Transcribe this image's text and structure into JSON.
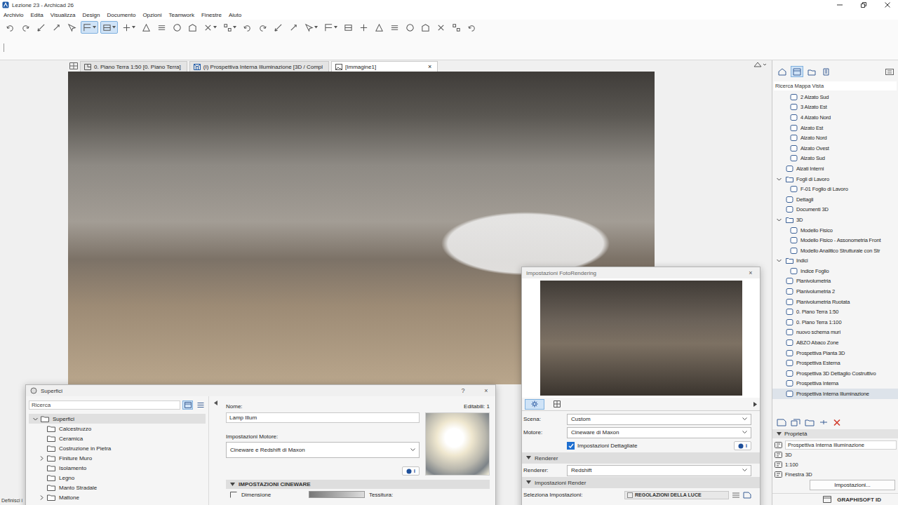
{
  "window": {
    "title": "Lezione 23 - Archicad 26"
  },
  "menu": [
    "Archivio",
    "Edita",
    "Visualizza",
    "Design",
    "Documento",
    "Opzioni",
    "Teamwork",
    "Finestre",
    "Aiuto"
  ],
  "toolbar": [
    {
      "selected": false,
      "menu": false
    },
    {
      "selected": false,
      "menu": false
    },
    {
      "selected": false,
      "menu": false
    },
    {
      "selected": false,
      "menu": false
    },
    {
      "selected": false,
      "menu": false
    },
    {
      "selected": true,
      "menu": true
    },
    {
      "selected": true,
      "menu": true
    },
    {
      "selected": false,
      "menu": true
    },
    {
      "selected": false,
      "menu": false
    },
    {
      "selected": false,
      "menu": false
    },
    {
      "selected": false,
      "menu": false
    },
    {
      "selected": false,
      "menu": false
    },
    {
      "selected": false,
      "menu": true
    },
    {
      "selected": false,
      "menu": true
    },
    {
      "selected": false,
      "menu": false
    },
    {
      "selected": false,
      "menu": false
    },
    {
      "selected": false,
      "menu": false
    },
    {
      "selected": false,
      "menu": false
    },
    {
      "selected": false,
      "menu": true
    },
    {
      "selected": false,
      "menu": true
    },
    {
      "selected": false,
      "menu": false
    },
    {
      "selected": false,
      "menu": false
    },
    {
      "selected": false,
      "menu": false
    },
    {
      "selected": false,
      "menu": false
    },
    {
      "selected": false,
      "menu": false
    },
    {
      "selected": false,
      "menu": false
    },
    {
      "selected": false,
      "menu": false
    },
    {
      "selected": false,
      "menu": false
    },
    {
      "selected": false,
      "menu": false
    }
  ],
  "view_tabs": [
    {
      "label": "0. Piano Terra 1:50 [0. Piano Terra]",
      "kind": "plan",
      "selected": false,
      "closable": false
    },
    {
      "label": "(I) Prospettiva Interna Illuminazione [3D / Compl",
      "kind": "perspective",
      "selected": false,
      "closable": false
    },
    {
      "label": "[Immagine1]",
      "kind": "image",
      "selected": true,
      "closable": true
    }
  ],
  "tab_close": "×",
  "status_hint": "Definisci i",
  "navigator": {
    "modes": [
      {
        "selected": false
      },
      {
        "selected": true
      },
      {
        "selected": false
      },
      {
        "selected": false
      }
    ],
    "search": "Ricerca Mappa Vista",
    "items": [
      {
        "label": "2 Alzato Sud",
        "kind": "view",
        "depth": 2,
        "expanded": false,
        "selected": false
      },
      {
        "label": "3 Alzato Est",
        "kind": "view",
        "depth": 2,
        "expanded": false,
        "selected": false
      },
      {
        "label": "4 Alzato Nord",
        "kind": "view",
        "depth": 2,
        "expanded": false,
        "selected": false
      },
      {
        "label": "Alzato Est",
        "kind": "view",
        "depth": 2,
        "expanded": false,
        "selected": false
      },
      {
        "label": "Alzato Nord",
        "kind": "view",
        "depth": 2,
        "expanded": false,
        "selected": false
      },
      {
        "label": "Alzato Ovest",
        "kind": "view",
        "depth": 2,
        "expanded": false,
        "selected": false
      },
      {
        "label": "Alzato Sud",
        "kind": "view",
        "depth": 2,
        "expanded": false,
        "selected": false
      },
      {
        "label": "Alzati Interni",
        "kind": "view",
        "depth": 1,
        "expanded": false,
        "selected": false
      },
      {
        "label": "Fogli di Lavoro",
        "kind": "folder",
        "depth": 1,
        "expanded": true,
        "selected": false
      },
      {
        "label": "F-01 Foglio di Lavoro",
        "kind": "view",
        "depth": 2,
        "expanded": false,
        "selected": false
      },
      {
        "label": "Dettagli",
        "kind": "view",
        "depth": 1,
        "expanded": false,
        "selected": false
      },
      {
        "label": "Documenti 3D",
        "kind": "view",
        "depth": 1,
        "expanded": false,
        "selected": false
      },
      {
        "label": "3D",
        "kind": "folder",
        "depth": 1,
        "expanded": true,
        "selected": false
      },
      {
        "label": "Modello Fisico",
        "kind": "view",
        "depth": 2,
        "expanded": false,
        "selected": false
      },
      {
        "label": "Modello Fisico - Assonometria Front",
        "kind": "view",
        "depth": 2,
        "expanded": false,
        "selected": false
      },
      {
        "label": "Modello Analitico Strutturale con Str",
        "kind": "view",
        "depth": 2,
        "expanded": false,
        "selected": false
      },
      {
        "label": "Indici",
        "kind": "folder",
        "depth": 1,
        "expanded": true,
        "selected": false
      },
      {
        "label": "Indice Foglio",
        "kind": "view",
        "depth": 2,
        "expanded": false,
        "selected": false
      },
      {
        "label": "Planivolumetria",
        "kind": "view",
        "depth": 1,
        "expanded": false,
        "selected": false
      },
      {
        "label": "Planivolumetria 2",
        "kind": "view",
        "depth": 1,
        "expanded": false,
        "selected": false
      },
      {
        "label": "Planivolumetria Ruotata",
        "kind": "view",
        "depth": 1,
        "expanded": false,
        "selected": false
      },
      {
        "label": "0. Piano Terra 1:50",
        "kind": "view",
        "depth": 1,
        "expanded": false,
        "selected": false
      },
      {
        "label": "0. Piano Terra 1:100",
        "kind": "view",
        "depth": 1,
        "expanded": false,
        "selected": false
      },
      {
        "label": "nuovo schema muri",
        "kind": "view",
        "depth": 1,
        "expanded": false,
        "selected": false
      },
      {
        "label": "ABZO Abaco Zone",
        "kind": "view",
        "depth": 1,
        "expanded": false,
        "selected": false
      },
      {
        "label": "Prospettiva Pianta 3D",
        "kind": "view",
        "depth": 1,
        "expanded": false,
        "selected": false
      },
      {
        "label": "Prospettiva Esterna",
        "kind": "view",
        "depth": 1,
        "expanded": false,
        "selected": false
      },
      {
        "label": "Prospettiva 3D Dettaglio Costruttivo",
        "kind": "view",
        "depth": 1,
        "expanded": false,
        "selected": false
      },
      {
        "label": "Prospettiva Interna",
        "kind": "view",
        "depth": 1,
        "expanded": false,
        "selected": false
      },
      {
        "label": "Prospettiva Interna Illuminazione",
        "kind": "view",
        "depth": 1,
        "expanded": false,
        "selected": true
      }
    ]
  },
  "properties": {
    "title": "Proprietà",
    "expanded": true,
    "rows": [
      {
        "value": "Prospettiva Interna Illuminazione",
        "kind": "field"
      },
      {
        "value": "3D",
        "kind": "text"
      },
      {
        "value": "1:100",
        "kind": "text"
      },
      {
        "value": "Finestra 3D",
        "kind": "text"
      }
    ],
    "button": "Impostazioni..."
  },
  "statusbar": {
    "brand": "GRAPHISOFT ID"
  },
  "surfaces": {
    "title": "Superfici",
    "help": "?",
    "close": "×",
    "search": "Ricerca",
    "view_modes": [
      {
        "selected": true
      },
      {
        "selected": false
      }
    ],
    "tree": [
      {
        "label": "Superfici",
        "depth": 0,
        "expandable": true,
        "expanded": true,
        "selected": true
      },
      {
        "label": "Calcestruzzo",
        "depth": 1,
        "expandable": false,
        "expanded": false,
        "selected": false
      },
      {
        "label": "Ceramica",
        "depth": 1,
        "expandable": false,
        "expanded": false,
        "selected": false
      },
      {
        "label": "Costruzione in Pietra",
        "depth": 1,
        "expandable": false,
        "expanded": false,
        "selected": false
      },
      {
        "label": "Finiture Muro",
        "depth": 1,
        "expandable": true,
        "expanded": false,
        "selected": false
      },
      {
        "label": "Isolamento",
        "depth": 1,
        "expandable": false,
        "expanded": false,
        "selected": false
      },
      {
        "label": "Legno",
        "depth": 1,
        "expandable": false,
        "expanded": false,
        "selected": false
      },
      {
        "label": "Manto Stradale",
        "depth": 1,
        "expandable": false,
        "expanded": false,
        "selected": false
      },
      {
        "label": "Mattone",
        "depth": 1,
        "expandable": true,
        "expanded": false,
        "selected": false
      }
    ],
    "name_label": "Nome:",
    "name": "Lamp Illum",
    "editable": "Editabili: 1",
    "engine_label": "Impostazioni Motore:",
    "engine": "Cineware e Redshift di Maxon",
    "info": "i",
    "section": "IMPOSTAZIONI CINEWARE",
    "section_expanded": true,
    "rows": [
      "Dimensione"
    ],
    "texture_label": "Tessitura:"
  },
  "photorender": {
    "title": "Impostazioni FotoRendering",
    "close": "×",
    "tabs": [
      {
        "selected": true
      },
      {
        "selected": false
      }
    ],
    "fields": [
      {
        "label": "Scena:",
        "value": "Custom"
      },
      {
        "label": "Motore:",
        "value": "Cineware di Maxon"
      }
    ],
    "detailed": {
      "label": "Impostazioni Dettagliate",
      "checked": true
    },
    "info": "i",
    "sections": [
      {
        "title": "Renderer",
        "expanded": true,
        "fields": [
          {
            "label": "Renderer:",
            "value": "Redshift"
          }
        ]
      },
      {
        "title": "Impostazioni Render",
        "expanded": true,
        "fields": []
      }
    ],
    "preset": {
      "label": "Seleziona Impostazioni:",
      "value": "REGOLAZIONI DELLA LUCE"
    }
  }
}
